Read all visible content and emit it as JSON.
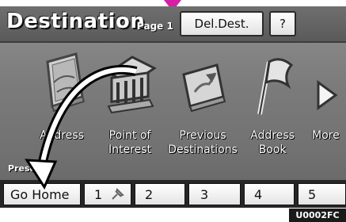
{
  "header": {
    "title": "Destination",
    "page": "Page 1",
    "del_dest": "Del.Dest.",
    "help": "?"
  },
  "menu": [
    {
      "icon": "map-icon",
      "label": [
        "Address"
      ]
    },
    {
      "icon": "building-icon",
      "label": [
        "Point of",
        "Interest"
      ]
    },
    {
      "icon": "previous-destination-icon",
      "label": [
        "Previous",
        "Destinations"
      ]
    },
    {
      "icon": "flag-icon",
      "label": [
        "Address",
        "Book"
      ]
    },
    {
      "icon": "more-arrow-icon",
      "label": [
        "More"
      ]
    }
  ],
  "preset_label": "Prese",
  "presets": [
    {
      "label": "Go Home"
    },
    {
      "label": "1",
      "icon": "pin-icon"
    },
    {
      "label": "2"
    },
    {
      "label": "3"
    },
    {
      "label": "4"
    },
    {
      "label": "5"
    }
  ],
  "image_code": "U0002FC",
  "colors": {
    "marker": "#d81ea6",
    "screen": "#7b7b7b",
    "header": "#5f5f5f"
  }
}
